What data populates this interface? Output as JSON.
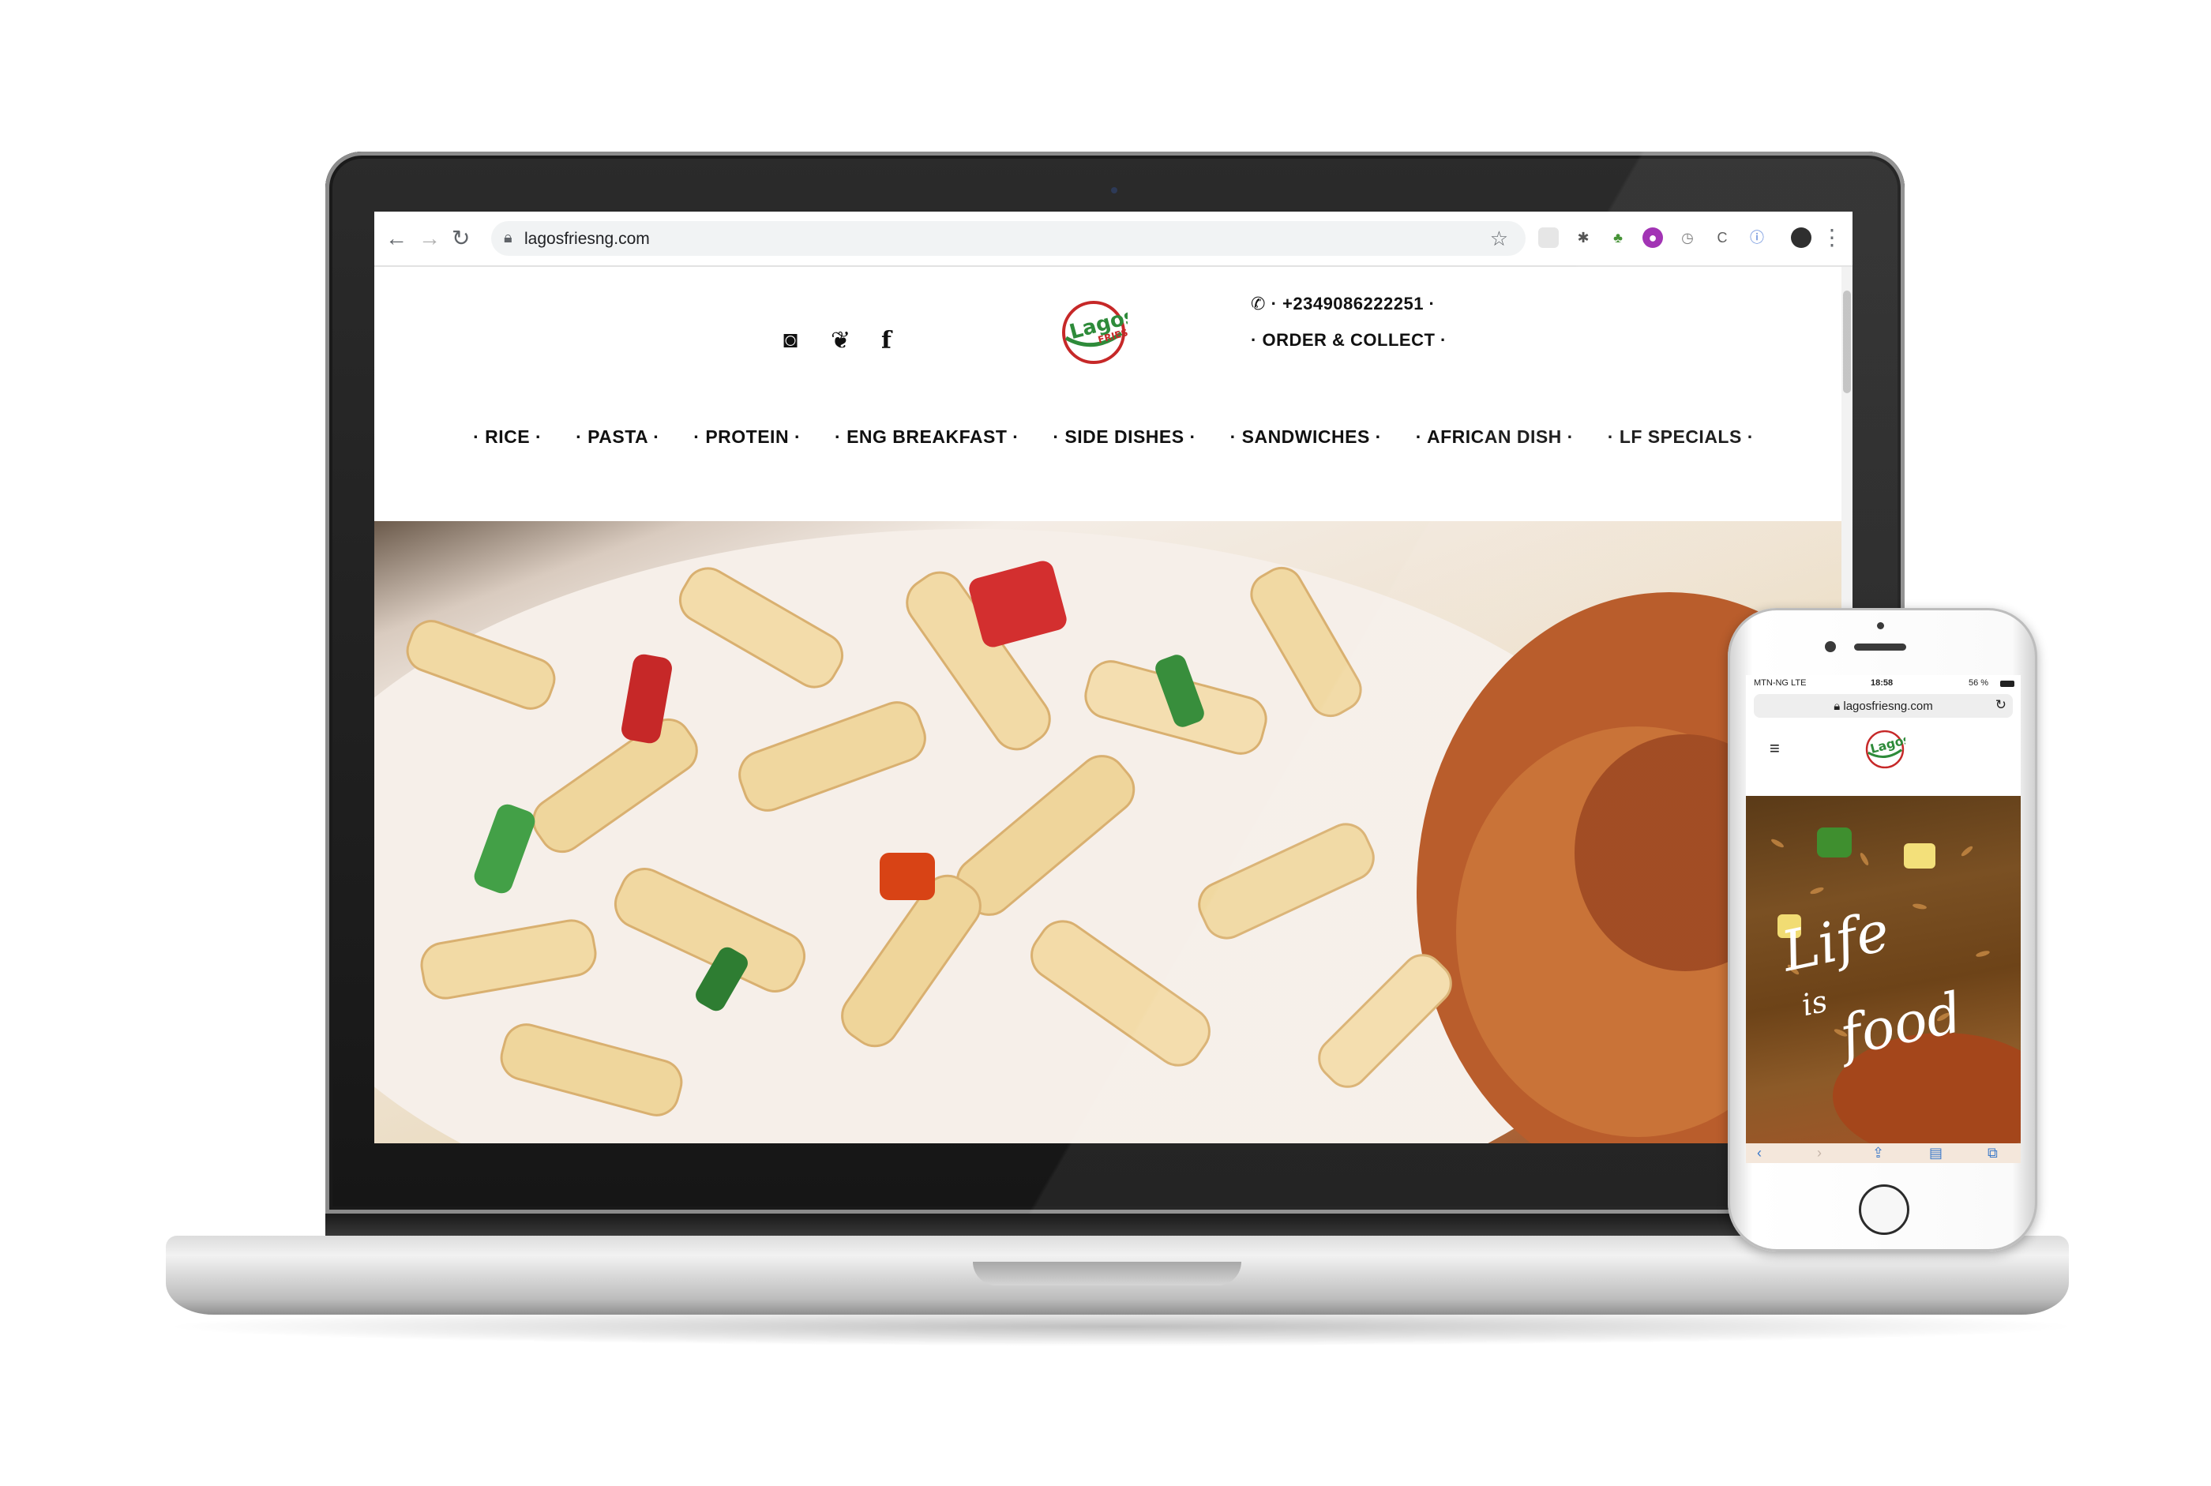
{
  "browser": {
    "url": "lagosfriesng.com",
    "back_icon": "arrow-left-icon",
    "forward_icon": "arrow-right-icon",
    "reload_icon": "reload-icon",
    "bookmark_icon": "star-icon"
  },
  "site": {
    "brand_colors": {
      "green": "#2e8b3a",
      "red": "#c62828",
      "dark": "#111111"
    },
    "social": [
      {
        "name": "instagram",
        "glyph": "◙"
      },
      {
        "name": "twitter",
        "glyph": "🐦"
      },
      {
        "name": "facebook",
        "glyph": "f"
      }
    ],
    "phone": "+2349086222251",
    "order": "ORDER & COLLECT",
    "menu": [
      "RICE",
      "PASTA",
      "PROTEIN",
      "ENG BREAKFAST",
      "SIDE DISHES",
      "SANDWICHES",
      "AFRICAN DISH",
      "LF SPECIALS"
    ]
  },
  "mobile": {
    "carrier": "MTN-NG  LTE",
    "time": "18:58",
    "battery": "56 %",
    "url": "lagosfriesng.com"
  }
}
